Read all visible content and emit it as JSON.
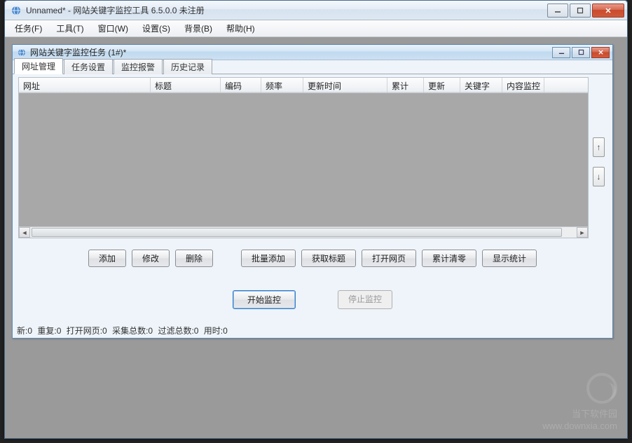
{
  "outer": {
    "title": "Unnamed* - 网站关键字监控工具 6.5.0.0  未注册"
  },
  "menu": {
    "items": [
      "任务(F)",
      "工具(T)",
      "窗口(W)",
      "设置(S)",
      "背景(B)",
      "帮助(H)"
    ]
  },
  "inner": {
    "title": "网站关键字监控任务  (1#)*"
  },
  "tabs": [
    "网址管理",
    "任务设置",
    "监控报警",
    "历史记录"
  ],
  "columns": [
    {
      "label": "网址",
      "width": 188
    },
    {
      "label": "标题",
      "width": 100
    },
    {
      "label": "编码",
      "width": 58
    },
    {
      "label": "频率",
      "width": 60
    },
    {
      "label": "更新时间",
      "width": 120
    },
    {
      "label": "累计",
      "width": 52
    },
    {
      "label": "更新",
      "width": 52
    },
    {
      "label": "关键字",
      "width": 60
    },
    {
      "label": "内容监控",
      "width": 60
    }
  ],
  "buttons_row1": [
    "添加",
    "修改",
    "删除",
    "批量添加",
    "获取标题",
    "打开网页",
    "累计清零",
    "显示统计"
  ],
  "buttons_row2": {
    "start": "开始监控",
    "stop": "停止监控"
  },
  "status": {
    "parts": [
      "新:0",
      "重复:0",
      "打开网页:0",
      "采集总数:0",
      "过滤总数:0",
      "用时:0"
    ]
  },
  "watermark": {
    "line1": "当下软件园",
    "line2": "www.downxia.com"
  }
}
